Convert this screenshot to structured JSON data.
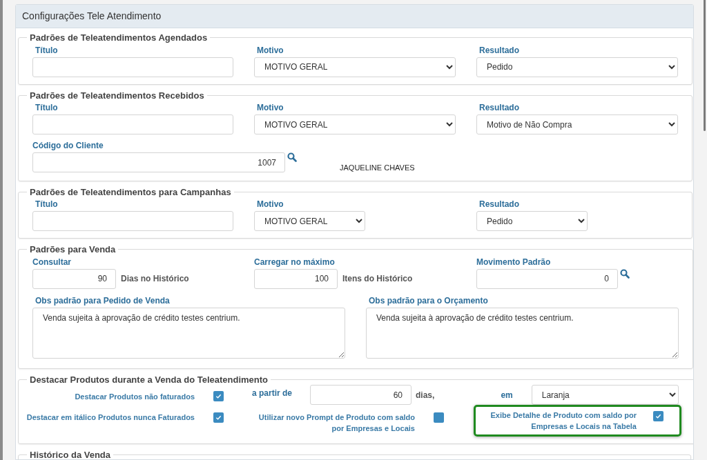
{
  "panel_title": "Configurações Tele Atendimento",
  "sections": [
    {
      "kind": "defaults",
      "legend": "Padrões de Teleatendimentos Agendados",
      "fields": [
        {
          "kind": "text",
          "label": "Título"
        },
        {
          "kind": "select",
          "label": "Motivo",
          "value": "MOTIVO GERAL"
        },
        {
          "kind": "select",
          "label": "Resultado",
          "value": "Pedido"
        }
      ]
    },
    {
      "kind": "defaults",
      "legend": "Padrões de Teleatendimentos Recebidos",
      "fields": [
        {
          "kind": "text",
          "label": "Título"
        },
        {
          "kind": "select",
          "label": "Motivo",
          "value": "MOTIVO GERAL"
        },
        {
          "kind": "select",
          "label": "Resultado",
          "value": "Motivo de Não Compra"
        }
      ],
      "customer": {
        "label": "Código do Cliente",
        "value": "1007",
        "name": "JAQUELINE CHAVES"
      }
    },
    {
      "kind": "defaults_narrow",
      "legend": "Padrões de Teleatendimentos para Campanhas",
      "fields": [
        {
          "kind": "text",
          "label": "Título"
        },
        {
          "kind": "select",
          "label": "Motivo",
          "value": "MOTIVO GERAL"
        },
        {
          "kind": "select",
          "label": "Resultado",
          "value": "Pedido"
        }
      ]
    },
    {
      "kind": "sale",
      "legend": "Padrões para Venda",
      "consult": {
        "label": "Consultar",
        "value": "90",
        "suffix": "Dias no Histórico"
      },
      "load": {
        "label": "Carregar no máximo",
        "value": "100",
        "suffix": "Itens do Histórico"
      },
      "movement": {
        "label": "Movimento Padrão",
        "value": "0"
      },
      "notes": [
        {
          "label": "Obs padrão para Pedido de Venda",
          "value": "Venda sujeita à aprovação de crédito testes centrium."
        },
        {
          "label": "Obs padrão para o Orçamento",
          "value": "Venda sujeita à aprovação de crédito testes centrium."
        }
      ]
    },
    {
      "kind": "highlight",
      "legend": "Destacar Produtos durante a Venda do Teleatendimento",
      "from": {
        "label": "a partir de",
        "value": "60",
        "suffix": "dias,"
      },
      "color": {
        "label": "em",
        "value": "Laranja"
      },
      "items": [
        {
          "label": "Destacar Produtos não faturados",
          "checked": true,
          "highlighted": false
        },
        {
          "label": "Destacar em itálico Produtos nunca Faturados",
          "checked": true,
          "highlighted": false
        },
        {
          "label": "Utilizar novo Prompt de Produto com saldo por Empresas e Locais",
          "checked": false,
          "highlighted": false
        },
        {
          "label": "Exibe Detalhe de Produto com saldo por Empresas e Locais na Tabela",
          "checked": true,
          "highlighted": true
        }
      ]
    },
    {
      "kind": "history",
      "legend": "Histórico da Venda"
    }
  ]
}
